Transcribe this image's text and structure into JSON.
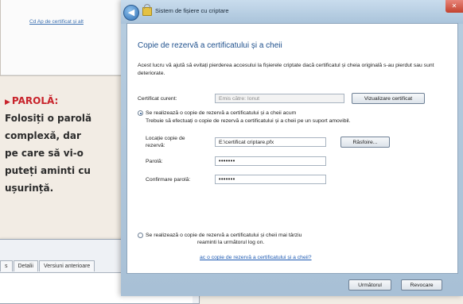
{
  "background": {
    "top_crumb": "Cd Ap de certificat și alt",
    "parola_title": "PAROLĂ:",
    "parola_lines": [
      "Folosiți o parolă",
      "complexă, dar",
      "pe care să vi-o",
      "puteți aminti cu",
      "ușurință."
    ]
  },
  "props_dialog": {
    "close_glyph": "✕",
    "tabs": [
      "s",
      "Detalii",
      "Versiuni anterioare"
    ]
  },
  "wizard": {
    "title": "Sistem de fișiere cu criptare",
    "close_glyph": "✕",
    "back_glyph": "◀",
    "heading": "Copie de rezervă a certificatului și a cheii",
    "description": "Acest lucru vă ajută să evitați pierderea accesului la fișierele criptate dacă certificatul și cheia originală s-au pierdut sau sunt deteriorate.",
    "current_cert_label": "Certificat curent:",
    "current_cert_value": "Emis către: Ionut",
    "view_cert_button": "Vizualizare certificat",
    "option_now_label": "Se realizează o copie de rezervă a certificatului și a cheii acum",
    "option_now_hint": "Trebuie să efectuați o copie de rezervă a certificatului și a cheii pe un suport amovibil.",
    "backup_location_label": "Locație copie de rezervă:",
    "backup_location_value": "E:\\certificat criptare.pfx",
    "browse_button": "Răsfoire...",
    "password_label": "Parolă:",
    "password_value": "•••••••",
    "confirm_password_label": "Confirmare parolă:",
    "confirm_password_value": "•••••••",
    "option_later_label": "Se realizează o copie de rezervă a certificatului și cheii mai târziu",
    "option_later_hint": "reaminti la următorul log on.",
    "help_link": "ac o copie de rezervă a certificatului și a cheii?",
    "next_button": "Următorul",
    "cancel_button": "Revocare"
  }
}
